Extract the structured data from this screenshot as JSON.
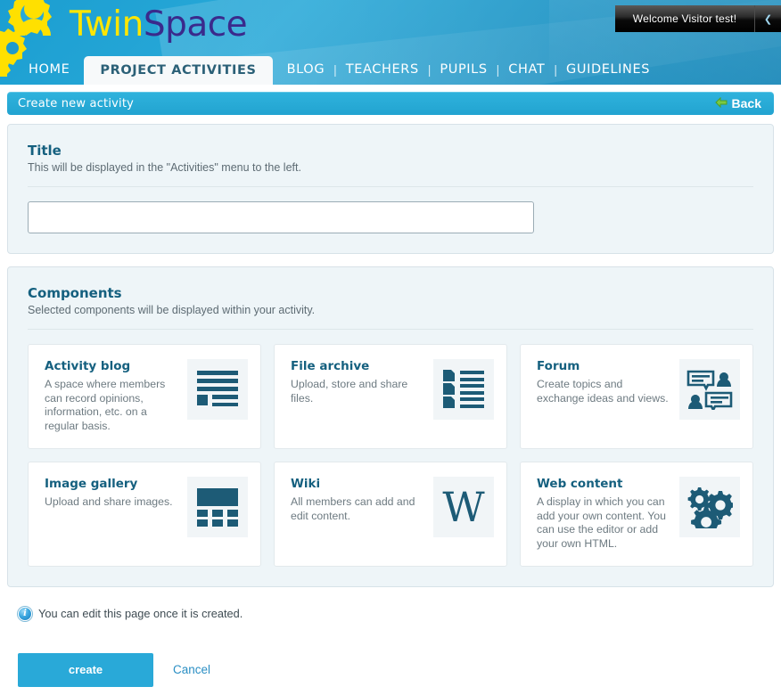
{
  "header": {
    "brand_twin": "Twin",
    "brand_space": "Space",
    "welcome": "Welcome Visitor test!",
    "welcome_arrow_icon": "chevron-down-icon",
    "logo_icon": "twinspace-gears-logo",
    "nav": [
      {
        "label": "HOME",
        "active": false,
        "sep_after": false
      },
      {
        "label": "PROJECT ACTIVITIES",
        "active": true,
        "sep_after": false
      },
      {
        "label": "BLOG",
        "active": false,
        "sep_after": true
      },
      {
        "label": "TEACHERS",
        "active": false,
        "sep_after": true
      },
      {
        "label": "PUPILS",
        "active": false,
        "sep_after": true
      },
      {
        "label": "CHAT",
        "active": false,
        "sep_after": true
      },
      {
        "label": "GUIDELINES",
        "active": false,
        "sep_after": false
      }
    ],
    "nav_separator": "|"
  },
  "titlebar": {
    "title": "Create new activity",
    "back_label": "Back",
    "back_icon": "arrow-left-icon"
  },
  "title_section": {
    "heading": "Title",
    "subtext": "This will be displayed in the \"Activities\" menu to the left.",
    "input_value": "",
    "input_placeholder": ""
  },
  "components_section": {
    "heading": "Components",
    "subtext": "Selected components will be displayed within your activity.",
    "cards": [
      {
        "title": "Activity blog",
        "desc": "A space where members can record opinions, information, etc. on a regular basis.",
        "icon": "blog-lines-icon"
      },
      {
        "title": "File archive",
        "desc": "Upload, store and share files.",
        "icon": "file-list-icon"
      },
      {
        "title": "Forum",
        "desc": "Create topics and exchange ideas and views.",
        "icon": "forum-speech-bubbles-icon"
      },
      {
        "title": "Image gallery",
        "desc": "Upload and share images.",
        "icon": "image-grid-icon"
      },
      {
        "title": "Wiki",
        "desc": "All members can add and edit content.",
        "icon": "wiki-w-icon"
      },
      {
        "title": "Web content",
        "desc": "A display in which you can add your own content. You can use the editor or add your own HTML.",
        "icon": "gears-icon"
      }
    ]
  },
  "footer": {
    "note": "You can edit this page once it is created.",
    "note_icon": "info-icon",
    "create_label": "create",
    "cancel_label": "Cancel"
  },
  "colors": {
    "header_blue": "#29a9d8",
    "accent_blue": "#29a9d8",
    "heading_teal": "#15607f",
    "icon_teal": "#1d5b76",
    "panel_bg": "#eef5f8",
    "brand_yellow": "#ffe600",
    "brand_purple": "#3a2a8c",
    "link_blue": "#2b8fc4"
  }
}
